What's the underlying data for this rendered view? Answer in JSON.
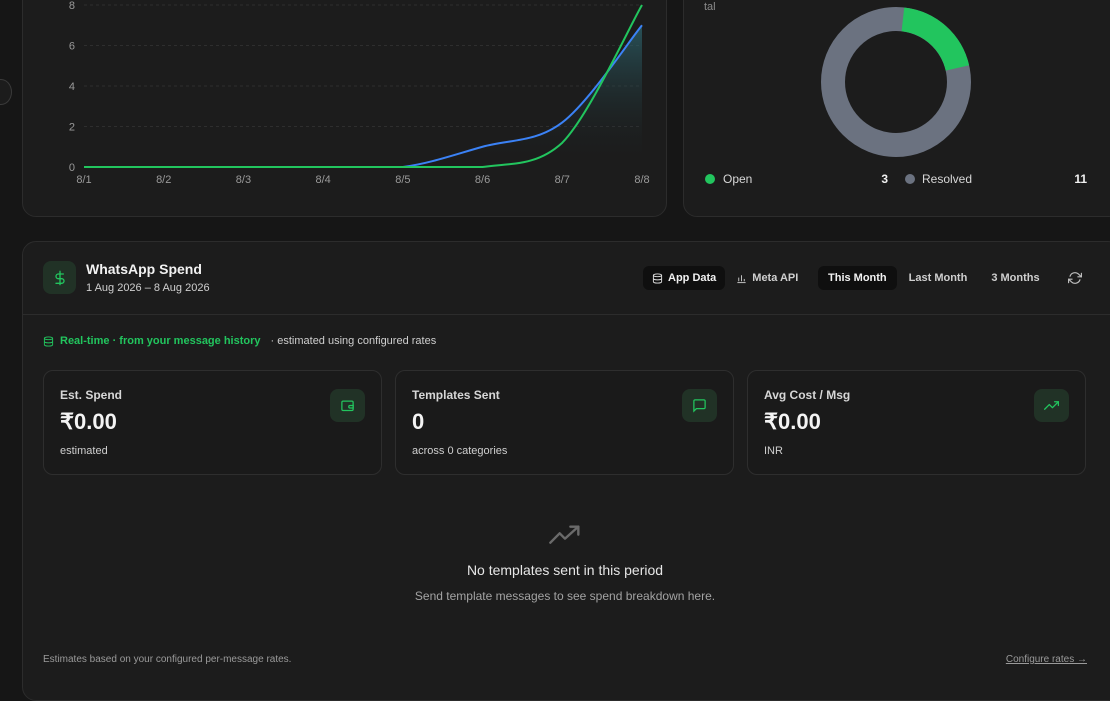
{
  "activity_chart": {
    "y_ticks": [
      "8",
      "6",
      "4",
      "2",
      "0"
    ],
    "x_ticks": [
      "8/1",
      "8/2",
      "8/3",
      "8/4",
      "8/5",
      "8/6",
      "8/7",
      "8/8"
    ],
    "colors": {
      "series_a": "#22c55e",
      "series_b": "#3b82f6"
    }
  },
  "chart_data": {
    "type": "line",
    "x": [
      "8/1",
      "8/2",
      "8/3",
      "8/4",
      "8/5",
      "8/6",
      "8/7",
      "8/8"
    ],
    "ylim": [
      0,
      8
    ],
    "series": [
      {
        "color": "#22c55e",
        "values": [
          0,
          0,
          0,
          0,
          0,
          0,
          1.2,
          8
        ]
      },
      {
        "color": "#3b82f6",
        "values": [
          0,
          0,
          0,
          0,
          0,
          1,
          2.2,
          7
        ]
      }
    ]
  },
  "conversation_status": {
    "header_fragment": "tal",
    "legend": [
      {
        "label": "Open",
        "count": "3",
        "color": "#22c55e"
      },
      {
        "label": "Resolved",
        "count": "11",
        "color": "#6b7280"
      }
    ]
  },
  "spend": {
    "title": "WhatsApp Spend",
    "date_range": "1 Aug 2026 – 8 Aug 2026",
    "source_tabs": [
      "App Data",
      "Meta API"
    ],
    "period_tabs": [
      "This Month",
      "Last Month",
      "3 Months"
    ],
    "notice_highlight": "Real-time · from your message history",
    "notice_rest": "· estimated using configured rates",
    "stats": [
      {
        "label": "Est. Spend",
        "value": "₹0.00",
        "sub": "estimated"
      },
      {
        "label": "Templates Sent",
        "value": "0",
        "sub": "across 0 categories"
      },
      {
        "label": "Avg Cost / Msg",
        "value": "₹0.00",
        "sub": "INR"
      }
    ],
    "empty_title": "No templates sent in this period",
    "empty_sub": "Send template messages to see spend breakdown here.",
    "footer_note": "Estimates based on your configured per-message rates.",
    "configure_link": "Configure rates →"
  }
}
